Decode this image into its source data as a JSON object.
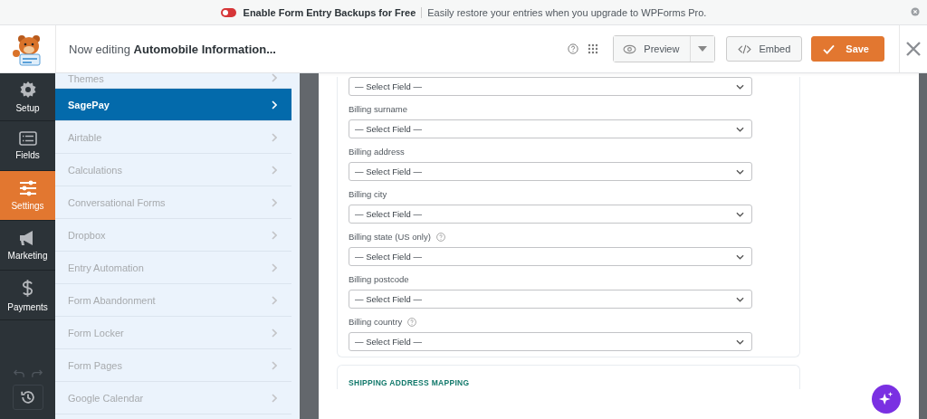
{
  "banner": {
    "toggle_on": false,
    "title": "Enable Form Entry Backups for Free",
    "text": "Easily restore your entries when you upgrade to WPForms Pro."
  },
  "header": {
    "prefix": "Now editing",
    "form_name": "Automobile Information...",
    "buttons": [
      {
        "kind": "preview",
        "label": "Preview"
      },
      {
        "kind": "embed",
        "label": "Embed"
      },
      {
        "kind": "save",
        "label": "Save"
      }
    ]
  },
  "sidebar": {
    "items": [
      {
        "kind": "setup",
        "label": "Setup",
        "selected": false
      },
      {
        "kind": "fields",
        "label": "Fields",
        "selected": false
      },
      {
        "kind": "settings",
        "label": "Settings",
        "selected": true
      },
      {
        "kind": "marketing",
        "label": "Marketing",
        "selected": false
      },
      {
        "kind": "payments",
        "label": "Payments",
        "selected": false
      }
    ]
  },
  "submenu": {
    "items": [
      {
        "label": "Themes",
        "selected": false
      },
      {
        "label": "SagePay",
        "selected": true
      },
      {
        "label": "Airtable",
        "selected": false
      },
      {
        "label": "Calculations",
        "selected": false
      },
      {
        "label": "Conversational Forms",
        "selected": false
      },
      {
        "label": "Dropbox",
        "selected": false
      },
      {
        "label": "Entry Automation",
        "selected": false
      },
      {
        "label": "Form Abandonment",
        "selected": false
      },
      {
        "label": "Form Locker",
        "selected": false
      },
      {
        "label": "Form Pages",
        "selected": false
      },
      {
        "label": "Google Calendar",
        "selected": false
      }
    ]
  },
  "fields": [
    {
      "value": "— Select Field —"
    },
    {
      "label": "Billing surname",
      "help": false,
      "value": "— Select Field —"
    },
    {
      "label": "Billing address",
      "help": false,
      "value": "— Select Field —"
    },
    {
      "label": "Billing city",
      "help": false,
      "value": "— Select Field —"
    },
    {
      "label": "Billing state (US only)",
      "help": true,
      "value": "— Select Field —"
    },
    {
      "label": "Billing postcode",
      "help": false,
      "value": "— Select Field —"
    },
    {
      "label": "Billing country",
      "help": true,
      "value": "— Select Field —"
    }
  ],
  "next_section": {
    "title": "SHIPPING ADDRESS MAPPING"
  }
}
